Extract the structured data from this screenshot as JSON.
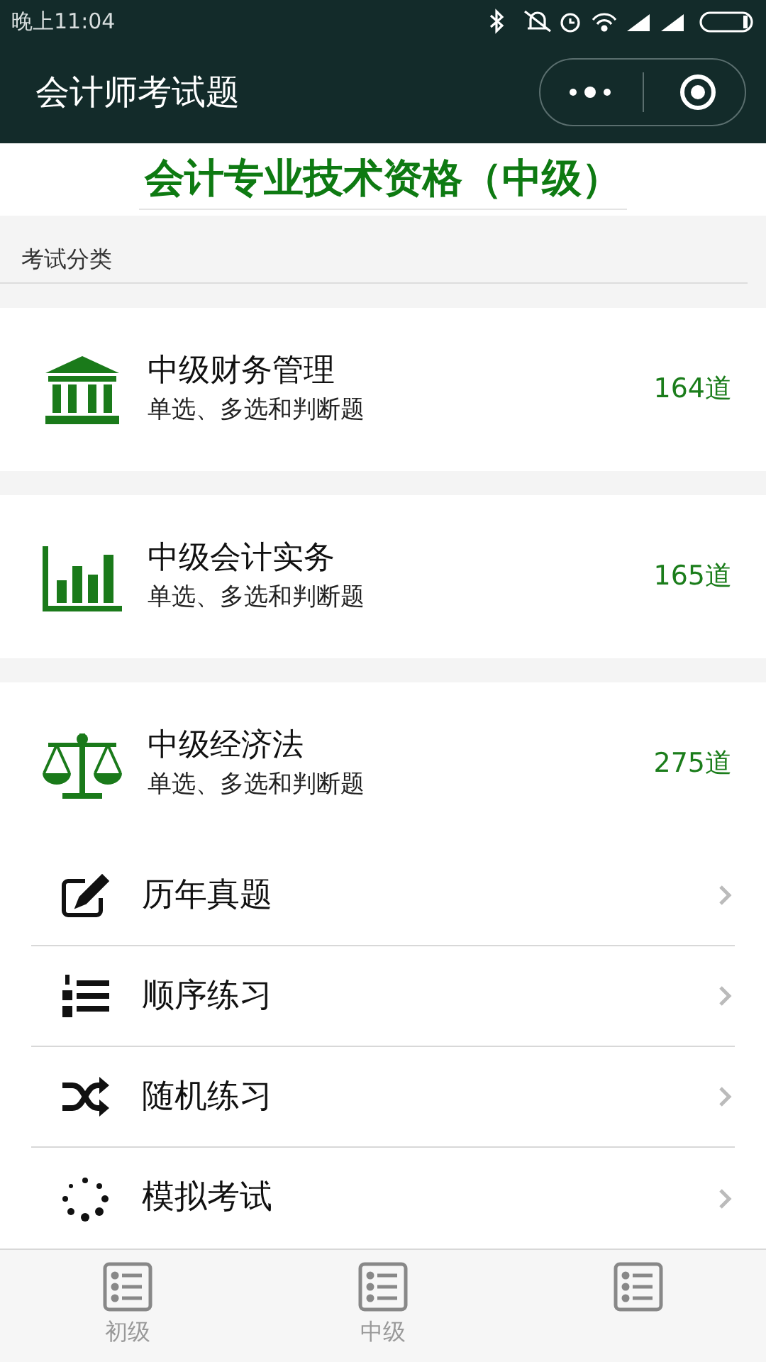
{
  "status_bar": {
    "time": "晚上11:04"
  },
  "header": {
    "title": "会计师考试题"
  },
  "banner": {
    "title": "会计专业技术资格（中级）"
  },
  "section": {
    "title": "考试分类"
  },
  "subjects": [
    {
      "kind": "bank",
      "title": "中级财务管理",
      "subtitle": "单选、多选和判断题",
      "count": "164道"
    },
    {
      "kind": "chart",
      "title": "中级会计实务",
      "subtitle": "单选、多选和判断题",
      "count": "165道"
    },
    {
      "kind": "scale",
      "title": "中级经济法",
      "subtitle": "单选、多选和判断题",
      "count": "275道"
    }
  ],
  "menu": [
    {
      "kind": "edit",
      "label": "历年真题"
    },
    {
      "kind": "ordered",
      "label": "顺序练习"
    },
    {
      "kind": "shuffle",
      "label": "随机练习"
    },
    {
      "kind": "loading",
      "label": "模拟考试"
    }
  ],
  "tabs": [
    {
      "label": "初级",
      "selected": false
    },
    {
      "label": "中级",
      "selected": false
    },
    {
      "selected": false
    }
  ]
}
